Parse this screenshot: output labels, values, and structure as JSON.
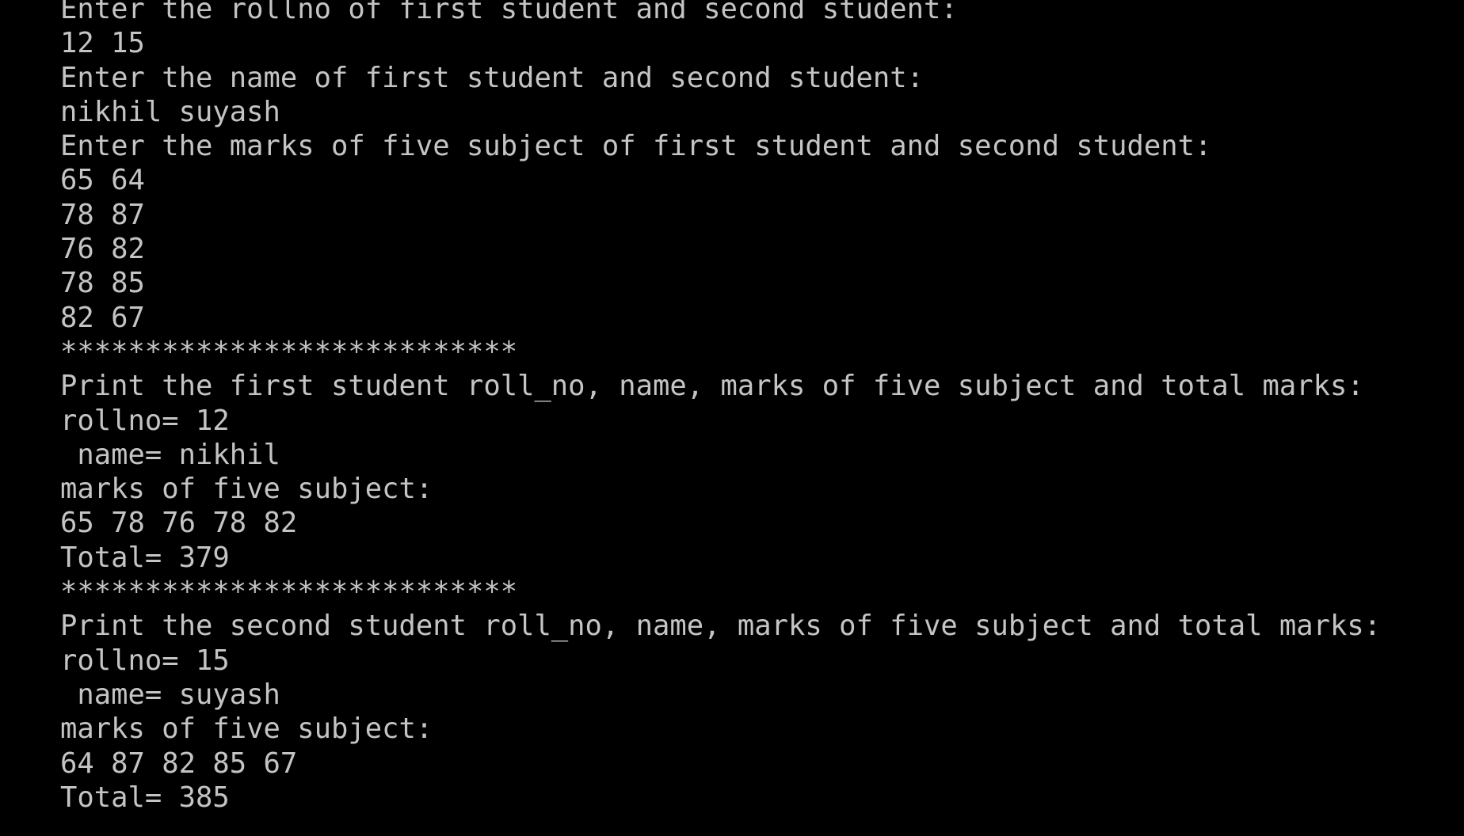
{
  "console": {
    "lines": [
      "Enter the rollno of first student and second student:",
      "12 15",
      "Enter the name of first student and second student:",
      "nikhil suyash",
      "Enter the marks of five subject of first student and second student:",
      "65 64",
      "78 87",
      "76 82",
      "78 85",
      "82 67",
      "***************************",
      "Print the first student roll_no, name, marks of five subject and total marks:",
      "rollno= 12",
      " name= nikhil",
      "marks of five subject:",
      "65 78 76 78 82",
      "Total= 379",
      "***************************",
      "Print the second student roll_no, name, marks of five subject and total marks:",
      "rollno= 15",
      " name= suyash",
      "marks of five subject:",
      "64 87 82 85 67",
      "Total= 385"
    ],
    "text_color": "#c4c4c4",
    "background": "#000000"
  }
}
